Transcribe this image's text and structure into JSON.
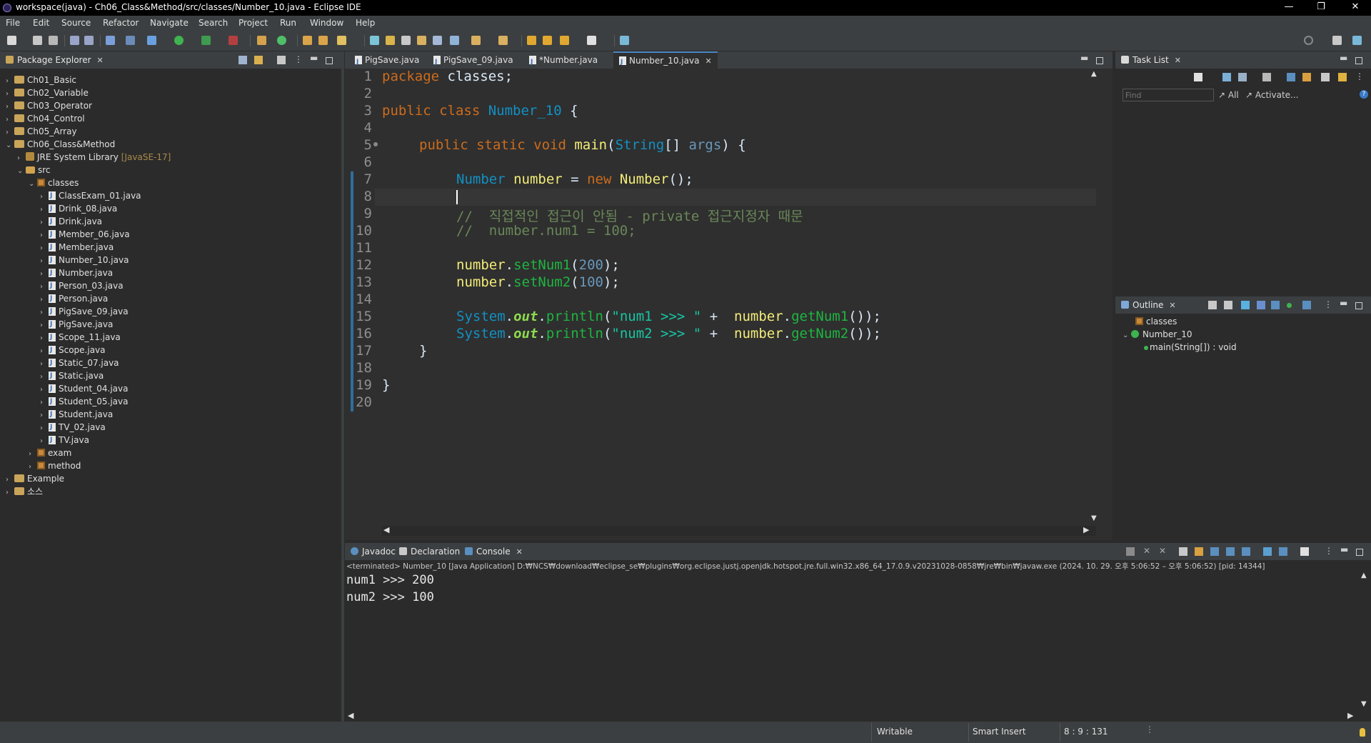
{
  "window": {
    "title": "workspace(java) - Ch06_Class&Method/src/classes/Number_10.java - Eclipse IDE",
    "minimize": "—",
    "restore": "❐",
    "close": "✕"
  },
  "menu": [
    "File",
    "Edit",
    "Source",
    "Refactor",
    "Navigate",
    "Search",
    "Project",
    "Run",
    "Window",
    "Help"
  ],
  "package_explorer": {
    "title": "Package Explorer",
    "tree": [
      {
        "label": "Ch01_Basic",
        "type": "project",
        "depth": 0,
        "expanded": false
      },
      {
        "label": "Ch02_Variable",
        "type": "project",
        "depth": 0,
        "expanded": false
      },
      {
        "label": "Ch03_Operator",
        "type": "project",
        "depth": 0,
        "expanded": false
      },
      {
        "label": "Ch04_Control",
        "type": "project",
        "depth": 0,
        "expanded": false
      },
      {
        "label": "Ch05_Array",
        "type": "project",
        "depth": 0,
        "expanded": false
      },
      {
        "label": "Ch06_Class&Method",
        "type": "project",
        "depth": 0,
        "expanded": true
      },
      {
        "label": "JRE System Library",
        "suffix": "[JavaSE-17]",
        "type": "library",
        "depth": 1,
        "expanded": false
      },
      {
        "label": "src",
        "type": "src",
        "depth": 1,
        "expanded": true
      },
      {
        "label": "classes",
        "type": "package",
        "depth": 2,
        "expanded": true
      },
      {
        "label": "ClassExam_01.java",
        "type": "java",
        "depth": 3,
        "expanded": false
      },
      {
        "label": "Drink_08.java",
        "type": "java",
        "depth": 3,
        "expanded": false
      },
      {
        "label": "Drink.java",
        "type": "java",
        "depth": 3,
        "expanded": false
      },
      {
        "label": "Member_06.java",
        "type": "java",
        "depth": 3,
        "expanded": false
      },
      {
        "label": "Member.java",
        "type": "java",
        "depth": 3,
        "expanded": false
      },
      {
        "label": "Number_10.java",
        "type": "java",
        "depth": 3,
        "expanded": false
      },
      {
        "label": "Number.java",
        "type": "java",
        "depth": 3,
        "expanded": false
      },
      {
        "label": "Person_03.java",
        "type": "java",
        "depth": 3,
        "expanded": false
      },
      {
        "label": "Person.java",
        "type": "java",
        "depth": 3,
        "expanded": false
      },
      {
        "label": "PigSave_09.java",
        "type": "java",
        "depth": 3,
        "expanded": false
      },
      {
        "label": "PigSave.java",
        "type": "java",
        "depth": 3,
        "expanded": false
      },
      {
        "label": "Scope_11.java",
        "type": "java",
        "depth": 3,
        "expanded": false
      },
      {
        "label": "Scope.java",
        "type": "java",
        "depth": 3,
        "expanded": false
      },
      {
        "label": "Static_07.java",
        "type": "java",
        "depth": 3,
        "expanded": false
      },
      {
        "label": "Static.java",
        "type": "java",
        "depth": 3,
        "expanded": false
      },
      {
        "label": "Student_04.java",
        "type": "java",
        "depth": 3,
        "expanded": false
      },
      {
        "label": "Student_05.java",
        "type": "java",
        "depth": 3,
        "expanded": false
      },
      {
        "label": "Student.java",
        "type": "java",
        "depth": 3,
        "expanded": false
      },
      {
        "label": "TV_02.java",
        "type": "java",
        "depth": 3,
        "expanded": false
      },
      {
        "label": "TV.java",
        "type": "java",
        "depth": 3,
        "expanded": false
      },
      {
        "label": "exam",
        "type": "package",
        "depth": 2,
        "expanded": false
      },
      {
        "label": "method",
        "type": "package",
        "depth": 2,
        "expanded": false
      },
      {
        "label": "Example",
        "type": "project",
        "depth": 0,
        "expanded": false
      },
      {
        "label": "소스",
        "type": "project",
        "depth": 0,
        "expanded": false
      }
    ]
  },
  "editor": {
    "tabs": [
      {
        "label": "PigSave.java",
        "active": false,
        "closable": false
      },
      {
        "label": "PigSave_09.java",
        "active": false,
        "closable": false
      },
      {
        "label": "*Number.java",
        "active": false,
        "closable": false
      },
      {
        "label": "Number_10.java",
        "active": true,
        "closable": true
      }
    ],
    "line_numbers": [
      "1",
      "2",
      "3",
      "4",
      "5",
      "6",
      "7",
      "8",
      "9",
      "10",
      "11",
      "12",
      "13",
      "14",
      "15",
      "16",
      "17",
      "18",
      "19",
      "20"
    ],
    "code": {
      "l1_kw": "package",
      "l1_rest": " classes;",
      "l3_kw": "public class",
      "l3_name": "Number_10",
      "l3_rest": " {",
      "l5_kw": "public static void",
      "l5_name": "main",
      "l5_p1": "(",
      "l5_type": "String",
      "l5_p2": "[] ",
      "l5_arg": "args",
      "l5_p3": ") {",
      "l7_type": "Number",
      "l7_var": "number",
      "l7_eq": " = ",
      "l7_new": "new",
      "l7_type2": "Number",
      "l7_end": "();",
      "l9_slash": "//",
      "l9_text": "  직접적인 접근이 안됨 - private 접근지정자 때문",
      "l10_slash": "//",
      "l10_text": "  number.num1 = 100;",
      "l12_obj": "number",
      "l12_dot": ".",
      "l12_m": "setNum1",
      "l12_o": "(",
      "l12_n": "200",
      "l12_c": ");",
      "l13_obj": "number",
      "l13_dot": ".",
      "l13_m": "setNum2",
      "l13_o": "(",
      "l13_n": "100",
      "l13_c": ");",
      "l15_sys": "System",
      "l15_dot1": ".",
      "l15_out": "out",
      "l15_dot2": ".",
      "l15_m": "println",
      "l15_o": "(",
      "l15_s": "\"num1 >>> \"",
      "l15_plus": " +  ",
      "l15_obj": "number",
      "l15_dot3": ".",
      "l15_g": "getNum1",
      "l15_c": "());",
      "l16_sys": "System",
      "l16_dot1": ".",
      "l16_out": "out",
      "l16_dot2": ".",
      "l16_m": "println",
      "l16_o": "(",
      "l16_s": "\"num2 >>> \"",
      "l16_plus": " +  ",
      "l16_obj": "number",
      "l16_dot3": ".",
      "l16_g": "getNum2",
      "l16_c": "());",
      "l17": "}",
      "l19": "}"
    }
  },
  "task_list": {
    "title": "Task List",
    "find_placeholder": "Find",
    "all_label": "All",
    "activate_label": "Activate..."
  },
  "outline": {
    "title": "Outline",
    "items": [
      {
        "label": "classes",
        "type": "package"
      },
      {
        "label": "Number_10",
        "type": "class"
      },
      {
        "label": "main(String[]) : void",
        "type": "method"
      }
    ]
  },
  "bottom_tabs": [
    {
      "label": "Javadoc",
      "active": false
    },
    {
      "label": "Declaration",
      "active": false
    },
    {
      "label": "Console",
      "active": true
    }
  ],
  "console": {
    "header": "<terminated> Number_10 [Java Application] D:₩NCS₩download₩eclipse_se₩plugins₩org.eclipse.justj.openjdk.hotspot.jre.full.win32.x86_64_17.0.9.v20231028-0858₩jre₩bin₩javaw.exe  (2024. 10. 29. 오후 5:06:52 – 오후 5:06:52) [pid: 14344]",
    "lines": [
      "num1 >>> 200",
      "num2 >>> 100"
    ]
  },
  "status": {
    "writable": "Writable",
    "insert_mode": "Smart Insert",
    "position": "8 : 9 : 131"
  },
  "colors": {
    "keyword": "#cc6c1d",
    "type": "#1290c3",
    "variable": "#f3ec79",
    "string": "#17c6a3",
    "number": "#6897bb",
    "comment": "#808080",
    "accent": "#4a88c7"
  }
}
